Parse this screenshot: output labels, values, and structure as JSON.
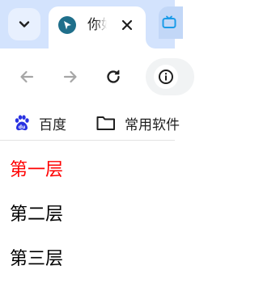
{
  "browser": {
    "tab": {
      "title": "你好"
    },
    "bookmarks": [
      {
        "label": "百度",
        "icon": "baidu-paw-icon"
      },
      {
        "label": "常用软件",
        "icon": "folder-icon"
      }
    ],
    "colors": {
      "tabstrip_bg": "#d3e3fd",
      "accent": "#1f6f8b",
      "baidu_blue": "#2932e1"
    }
  },
  "page": {
    "items": [
      {
        "text": "第一层",
        "color": "#ff0000"
      },
      {
        "text": "第二层",
        "color": "#000000"
      },
      {
        "text": "第三层",
        "color": "#000000"
      }
    ]
  }
}
